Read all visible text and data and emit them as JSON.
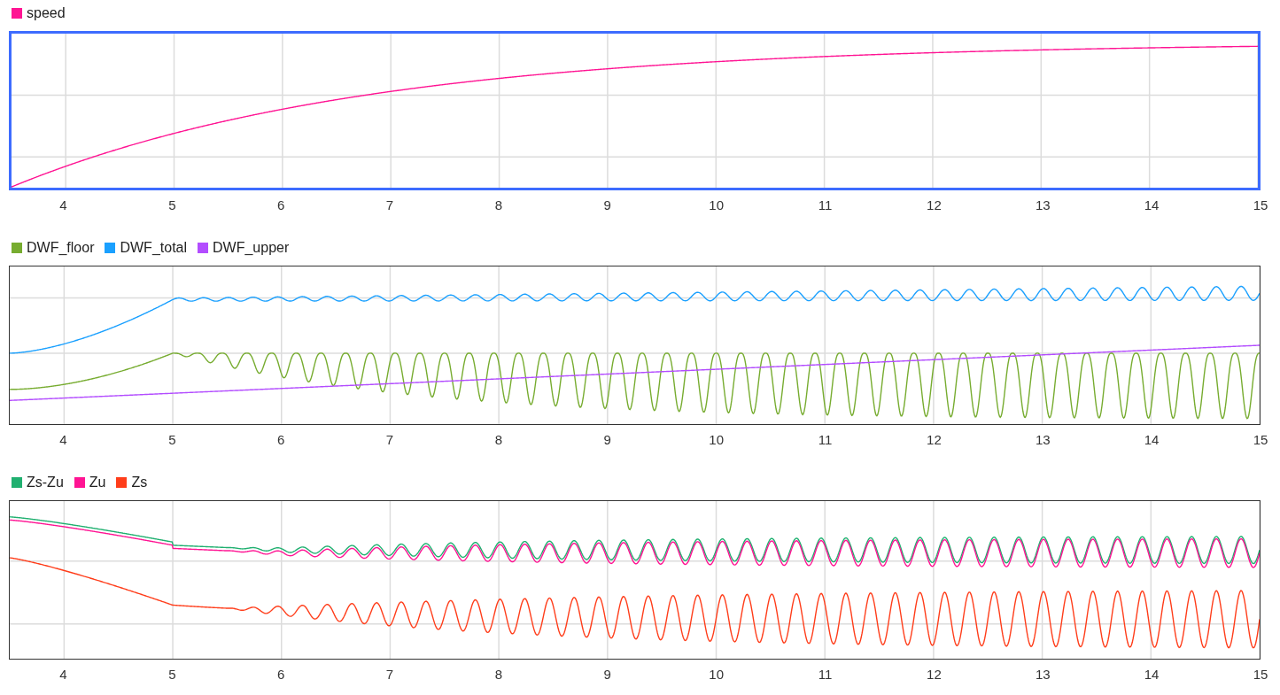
{
  "plots": [
    {
      "selected": true,
      "legend": [
        {
          "label": "speed",
          "color": "#ff1493"
        }
      ],
      "x_ticks": [
        "4",
        "5",
        "6",
        "7",
        "8",
        "9",
        "10",
        "11",
        "12",
        "13",
        "14",
        "15"
      ]
    },
    {
      "selected": false,
      "legend": [
        {
          "label": "DWF_floor",
          "color": "#77ac30"
        },
        {
          "label": "DWF_total",
          "color": "#1aa0ff"
        },
        {
          "label": "DWF_upper",
          "color": "#b34dff"
        }
      ],
      "x_ticks": [
        "4",
        "5",
        "6",
        "7",
        "8",
        "9",
        "10",
        "11",
        "12",
        "13",
        "14",
        "15"
      ]
    },
    {
      "selected": false,
      "legend": [
        {
          "label": "Zs-Zu",
          "color": "#20b070"
        },
        {
          "label": "Zu",
          "color": "#ff1493"
        },
        {
          "label": "Zs",
          "color": "#ff3d1a"
        }
      ],
      "x_ticks": [
        "4",
        "5",
        "6",
        "7",
        "8",
        "9",
        "10",
        "11",
        "12",
        "13",
        "14",
        "15"
      ]
    }
  ]
}
